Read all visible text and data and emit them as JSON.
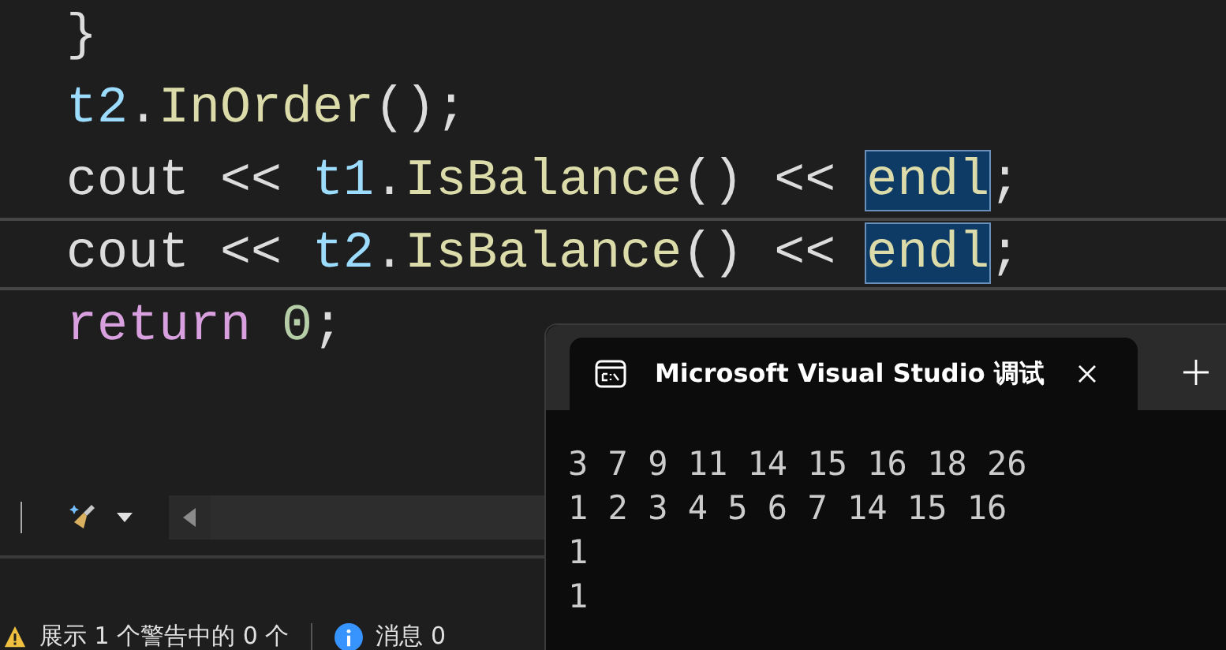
{
  "editor": {
    "lines": [
      {
        "current": false,
        "tokens": [
          {
            "kind": "punct",
            "text": "}",
            "highlighted": false
          }
        ]
      },
      {
        "current": false,
        "tokens": [
          {
            "kind": "variable",
            "text": "t2",
            "highlighted": false
          },
          {
            "kind": "punct",
            "text": ".",
            "highlighted": false
          },
          {
            "kind": "method",
            "text": "InOrder",
            "highlighted": false
          },
          {
            "kind": "punct",
            "text": "();",
            "highlighted": false
          }
        ]
      },
      {
        "current": false,
        "tokens": [
          {
            "kind": "plain",
            "text": "cout",
            "highlighted": false
          },
          {
            "kind": "punct",
            "text": " << ",
            "highlighted": false
          },
          {
            "kind": "variable",
            "text": "t1",
            "highlighted": false
          },
          {
            "kind": "punct",
            "text": ".",
            "highlighted": false
          },
          {
            "kind": "method",
            "text": "IsBalance",
            "highlighted": false
          },
          {
            "kind": "punct",
            "text": "() << ",
            "highlighted": false
          },
          {
            "kind": "method",
            "text": "endl",
            "highlighted": true
          },
          {
            "kind": "punct",
            "text": ";",
            "highlighted": false
          }
        ]
      },
      {
        "current": true,
        "tokens": [
          {
            "kind": "plain",
            "text": "cout",
            "highlighted": false
          },
          {
            "kind": "punct",
            "text": " << ",
            "highlighted": false
          },
          {
            "kind": "variable",
            "text": "t2",
            "highlighted": false
          },
          {
            "kind": "punct",
            "text": ".",
            "highlighted": false
          },
          {
            "kind": "method",
            "text": "IsBalance",
            "highlighted": false
          },
          {
            "kind": "punct",
            "text": "() << ",
            "highlighted": false
          },
          {
            "kind": "method",
            "text": "endl",
            "highlighted": true
          },
          {
            "kind": "punct",
            "text": ";",
            "highlighted": false
          }
        ]
      },
      {
        "current": false,
        "tokens": [
          {
            "kind": "keyword",
            "text": "return ",
            "highlighted": false
          },
          {
            "kind": "number",
            "text": "0",
            "highlighted": false
          },
          {
            "kind": "punct",
            "text": ";",
            "highlighted": false
          }
        ]
      }
    ]
  },
  "status": {
    "warnings": "展示 1 个警告中的 0 个",
    "messages": "消息 0"
  },
  "terminal": {
    "tab_title": "Microsoft Visual Studio 调试",
    "output": [
      "3 7 9 11 14 15 16 18 26",
      "1 2 3 4 5 6 7 14 15 16",
      "1",
      "1"
    ]
  }
}
